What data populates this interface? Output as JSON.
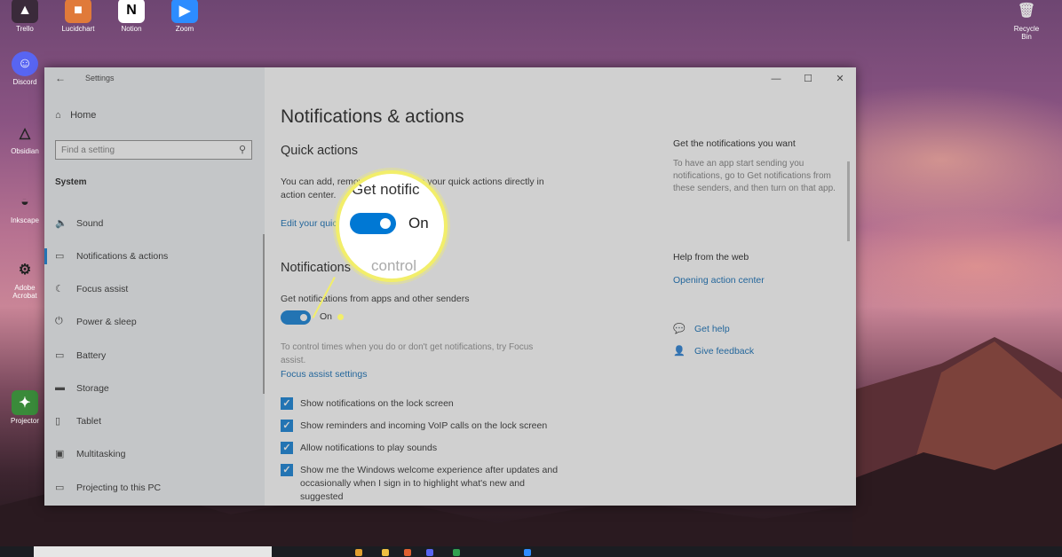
{
  "desktop": {
    "icons": [
      {
        "label": "Trello",
        "icon": "hat-icon"
      },
      {
        "label": "Lucidchart",
        "icon": "photo-icon"
      },
      {
        "label": "Notion",
        "icon": "notion-icon"
      },
      {
        "label": "Zoom",
        "icon": "camera-icon"
      },
      {
        "label": "Discord",
        "icon": "discord-icon"
      },
      {
        "label": "Obsidian",
        "icon": "pyramid-icon"
      },
      {
        "label": "Inkscape",
        "icon": "ufo-icon"
      },
      {
        "label": "Adobe Acrobat",
        "icon": "gear-icon"
      },
      {
        "label": "Projector",
        "icon": "app-icon"
      },
      {
        "label": "Recycle Bin",
        "icon": "bin-icon"
      }
    ]
  },
  "window": {
    "title": "Settings",
    "back_glyph": "←",
    "controls": [
      "—",
      "☐",
      "✕"
    ]
  },
  "sidebar": {
    "home_label": "Home",
    "search_placeholder": "Find a setting",
    "section_label": "System",
    "items": [
      {
        "label": "Sound",
        "icon": "speaker-icon"
      },
      {
        "label": "Notifications & actions",
        "icon": "notification-icon"
      },
      {
        "label": "Focus assist",
        "icon": "moon-icon"
      },
      {
        "label": "Power & sleep",
        "icon": "power-icon"
      },
      {
        "label": "Battery",
        "icon": "battery-icon"
      },
      {
        "label": "Storage",
        "icon": "storage-icon"
      },
      {
        "label": "Tablet",
        "icon": "tablet-icon"
      },
      {
        "label": "Multitasking",
        "icon": "multitasking-icon"
      },
      {
        "label": "Projecting to this PC",
        "icon": "projector-icon"
      }
    ],
    "active_index": 1
  },
  "main": {
    "title": "Notifications & actions",
    "quick_actions": {
      "heading": "Quick actions",
      "text_line1": "You can add, remove, or rearrange your quick actions directly in",
      "text_line2": "action center.",
      "link": "Edit your quick actions"
    },
    "notifications": {
      "heading": "Notifications",
      "toggle_label": "Get notifications from apps and other senders",
      "toggle_state": "On",
      "focus_text_line1": "To control times when you do or don't get notifications, try Focus",
      "focus_text_line2": "assist.",
      "focus_link": "Focus assist settings",
      "checkboxes": [
        {
          "label": "Show notifications on the lock screen",
          "checked": true
        },
        {
          "label": "Show reminders and incoming VoIP calls on the lock screen",
          "checked": true
        },
        {
          "label": "Allow notifications to play sounds",
          "checked": true
        },
        {
          "label": "Show me the Windows welcome experience after updates and",
          "label2": "occasionally when I sign in to highlight what's new and",
          "label3": "suggested",
          "checked": true
        }
      ]
    },
    "right": {
      "get_heading": "Get the notifications you want",
      "get_text": "To have an app start sending you notifications, go to Get notifications from these senders, and then turn on that app.",
      "help_heading": "Help from the web",
      "help_link": "Opening action center",
      "get_help": "Get help",
      "give_feedback": "Give feedback"
    }
  },
  "callout": {
    "top_text": "Get notific",
    "state": "On",
    "bottom_text": "control"
  },
  "colors": {
    "accent": "#0078d4",
    "callout": "#f2ee6a",
    "link": "#0063b1"
  }
}
